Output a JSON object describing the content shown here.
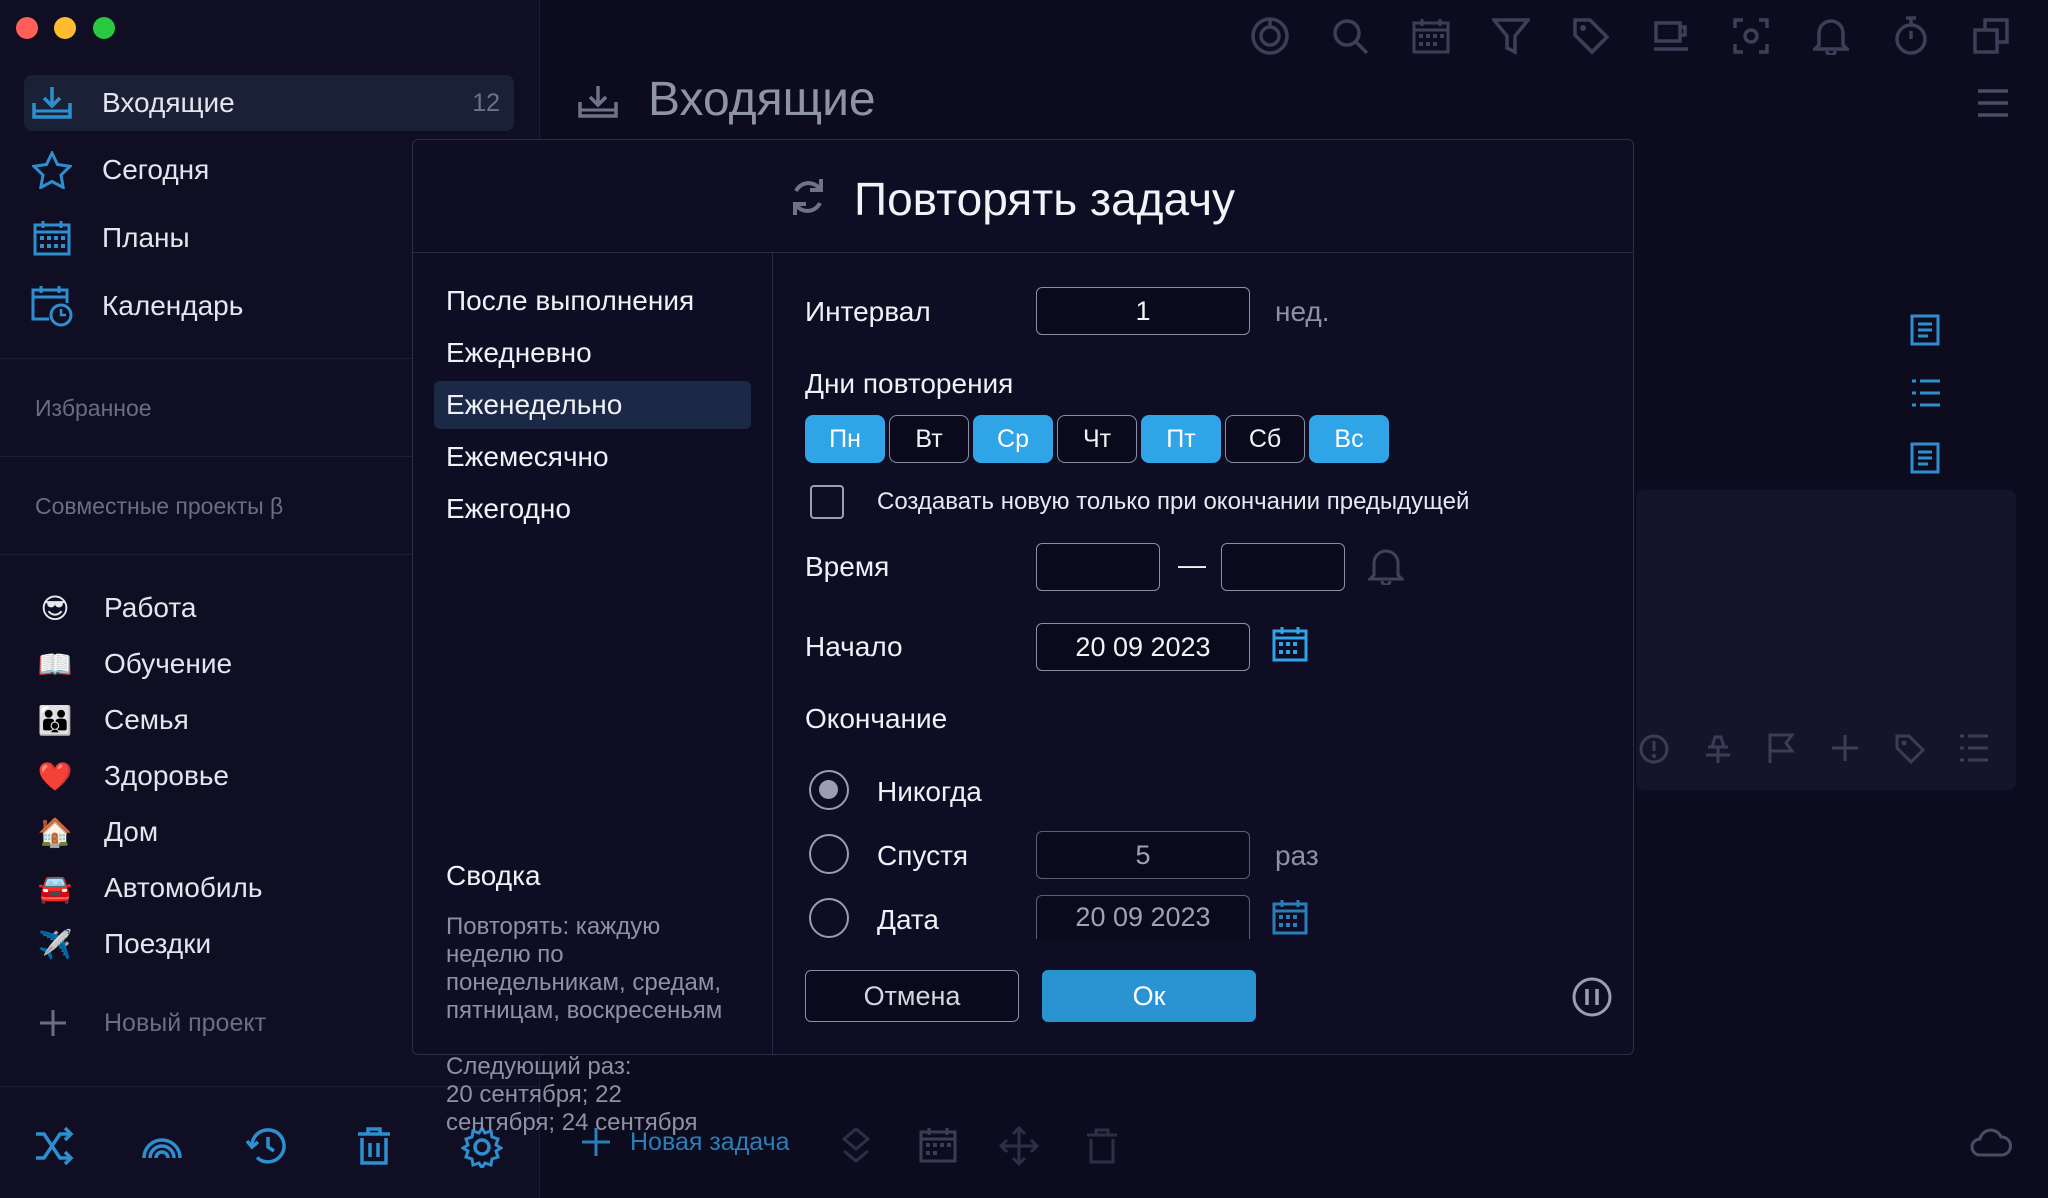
{
  "sidebar": {
    "nav": [
      {
        "label": "Входящие",
        "count": "12",
        "icon": "inbox-icon"
      },
      {
        "label": "Сегодня",
        "icon": "star-icon"
      },
      {
        "label": "Планы",
        "icon": "calendar-grid-icon"
      },
      {
        "label": "Календарь",
        "icon": "calendar-clock-icon"
      }
    ],
    "favorites_title": "Избранное",
    "shared_title": "Совместные проекты β",
    "projects": [
      {
        "label": "Работа",
        "emoji": "😎"
      },
      {
        "label": "Обучение",
        "emoji": "📖"
      },
      {
        "label": "Семья",
        "emoji": "👪"
      },
      {
        "label": "Здоровье",
        "emoji": "❤️"
      },
      {
        "label": "Дом",
        "emoji": "🏠"
      },
      {
        "label": "Автомобиль",
        "emoji": "🚘"
      },
      {
        "label": "Поездки",
        "emoji": "✈️"
      }
    ],
    "new_project": "Новый проект"
  },
  "main": {
    "title": "Входящие",
    "new_task": "Новая задача"
  },
  "dialog": {
    "title": "Повторять задачу",
    "options": [
      "После выполнения",
      "Ежедневно",
      "Еженедельно",
      "Ежемесячно",
      "Ежегодно"
    ],
    "selected_option": "Еженедельно",
    "summary_title": "Сводка",
    "summary_text": [
      "Повторять: каждую",
      "неделю по",
      "понедельникам, средам,",
      "пятницам, воскресеньям"
    ],
    "next_text": [
      "Следующий раз:",
      "20 сентября; 22",
      "сентября; 24 сентября"
    ],
    "interval_label": "Интервал",
    "interval_value": "1",
    "interval_unit": "нед.",
    "days_label": "Дни повторения",
    "days": [
      {
        "label": "Пн",
        "on": true
      },
      {
        "label": "Вт",
        "on": false
      },
      {
        "label": "Ср",
        "on": true
      },
      {
        "label": "Чт",
        "on": false
      },
      {
        "label": "Пт",
        "on": true
      },
      {
        "label": "Сб",
        "on": false
      },
      {
        "label": "Вс",
        "on": true
      }
    ],
    "only_after_label": "Создавать новую только при окончании предыдущей",
    "time_label": "Время",
    "time_dash": "—",
    "start_label": "Начало",
    "start_value": "20 09 2023",
    "end_label": "Окончание",
    "end_never": "Никогда",
    "end_after": "Спустя",
    "end_after_value": "5",
    "end_after_unit": "раз",
    "end_date": "Дата",
    "end_date_value": "20 09 2023",
    "cancel": "Отмена",
    "ok": "Ок"
  },
  "colors": {
    "accent": "#2fa4e7",
    "ok_button": "#2a93d1",
    "background": "#0d0b1e",
    "sidebar_bg": "#0f0e22",
    "selected_bg": "#1b2947"
  }
}
